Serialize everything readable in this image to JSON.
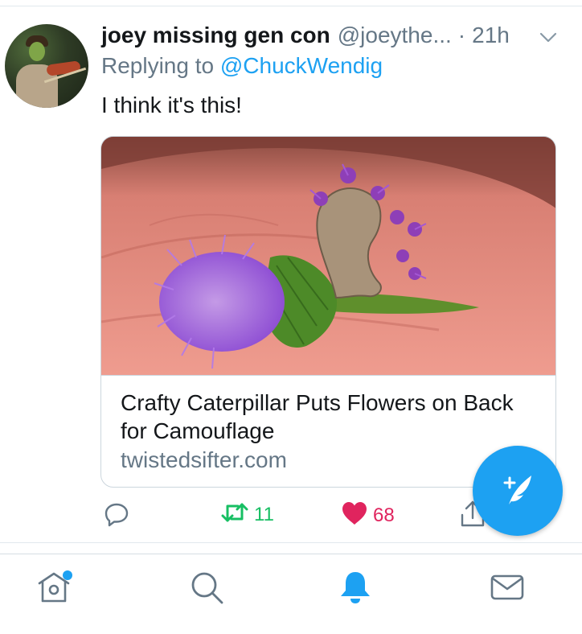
{
  "tweet": {
    "display_name": "joey missing gen con",
    "handle": "@joeythe...",
    "separator": "·",
    "time": "21h",
    "reply_prefix": "Replying to",
    "reply_mention": "@ChuckWendig",
    "text": "I think it's this!"
  },
  "card": {
    "title": "Crafty Caterpillar Puts Flowers on Back for Camouflage",
    "domain": "twistedsifter.com"
  },
  "actions": {
    "retweet_count": "11",
    "like_count": "68"
  },
  "colors": {
    "accent": "#1da1f2",
    "retweet": "#17bf63",
    "like": "#e0245e",
    "secondary_text": "#657786"
  },
  "icons": {
    "reply": "reply-icon",
    "retweet": "retweet-icon",
    "like": "heart-icon",
    "share": "share-icon",
    "compose": "compose-icon",
    "home": "home-icon",
    "search": "search-icon",
    "notifications": "bell-icon",
    "messages": "mail-icon"
  }
}
